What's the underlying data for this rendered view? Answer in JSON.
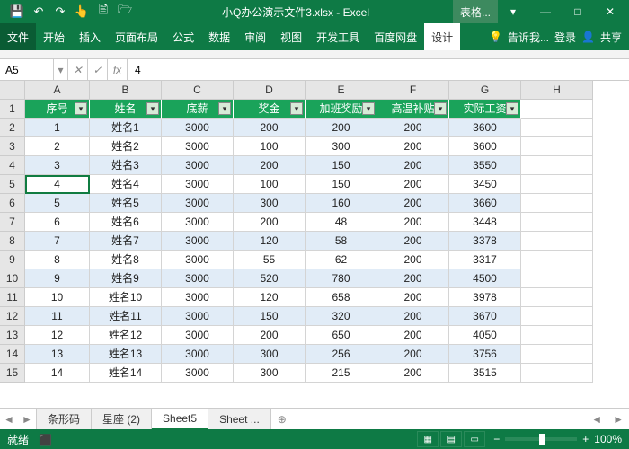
{
  "title": "小Q办公演示文件3.xlsx - Excel",
  "contextTab": "表格...",
  "qat": {
    "save": "💾",
    "undo": "↶",
    "redo": "↷",
    "touch": "👆",
    "new": "🖹",
    "open": "🗁"
  },
  "winctl": {
    "min": "—",
    "max": "□",
    "close": "✕",
    "ribmin": "▾",
    "help": "?"
  },
  "ribbon": {
    "file": "文件",
    "tabs": [
      "开始",
      "插入",
      "页面布局",
      "公式",
      "数据",
      "审阅",
      "视图",
      "开发工具",
      "百度网盘"
    ],
    "design": "设计",
    "tell": "告诉我...",
    "login": "登录",
    "share": "共享"
  },
  "namebox": "A5",
  "fx": "fx",
  "fval": "4",
  "cols": [
    "A",
    "B",
    "C",
    "D",
    "E",
    "F",
    "G",
    "H"
  ],
  "headers": [
    "序号",
    "姓名",
    "底薪",
    "奖金",
    "加班奖励",
    "高温补贴",
    "实际工资"
  ],
  "rows": [
    {
      "n": 1,
      "d": [
        "1",
        "姓名1",
        "3000",
        "200",
        "200",
        "200",
        "3600"
      ]
    },
    {
      "n": 2,
      "d": [
        "2",
        "姓名2",
        "3000",
        "100",
        "300",
        "200",
        "3600"
      ]
    },
    {
      "n": 3,
      "d": [
        "3",
        "姓名3",
        "3000",
        "200",
        "150",
        "200",
        "3550"
      ]
    },
    {
      "n": 4,
      "d": [
        "4",
        "姓名4",
        "3000",
        "100",
        "150",
        "200",
        "3450"
      ]
    },
    {
      "n": 5,
      "d": [
        "5",
        "姓名5",
        "3000",
        "300",
        "160",
        "200",
        "3660"
      ]
    },
    {
      "n": 6,
      "d": [
        "6",
        "姓名6",
        "3000",
        "200",
        "48",
        "200",
        "3448"
      ]
    },
    {
      "n": 7,
      "d": [
        "7",
        "姓名7",
        "3000",
        "120",
        "58",
        "200",
        "3378"
      ]
    },
    {
      "n": 8,
      "d": [
        "8",
        "姓名8",
        "3000",
        "55",
        "62",
        "200",
        "3317"
      ]
    },
    {
      "n": 9,
      "d": [
        "9",
        "姓名9",
        "3000",
        "520",
        "780",
        "200",
        "4500"
      ]
    },
    {
      "n": 10,
      "d": [
        "10",
        "姓名10",
        "3000",
        "120",
        "658",
        "200",
        "3978"
      ]
    },
    {
      "n": 11,
      "d": [
        "11",
        "姓名11",
        "3000",
        "150",
        "320",
        "200",
        "3670"
      ]
    },
    {
      "n": 12,
      "d": [
        "12",
        "姓名12",
        "3000",
        "200",
        "650",
        "200",
        "4050"
      ]
    },
    {
      "n": 13,
      "d": [
        "13",
        "姓名13",
        "3000",
        "300",
        "256",
        "200",
        "3756"
      ]
    },
    {
      "n": 14,
      "d": [
        "14",
        "姓名14",
        "3000",
        "300",
        "215",
        "200",
        "3515"
      ]
    }
  ],
  "sheets": [
    "条形码",
    "星座 (2)",
    "Sheet5",
    "Sheet ..."
  ],
  "activeSheet": 2,
  "status": {
    "ready": "就绪",
    "rec": "⬛",
    "zoom": "100%",
    "plus": "+",
    "minus": "−"
  }
}
